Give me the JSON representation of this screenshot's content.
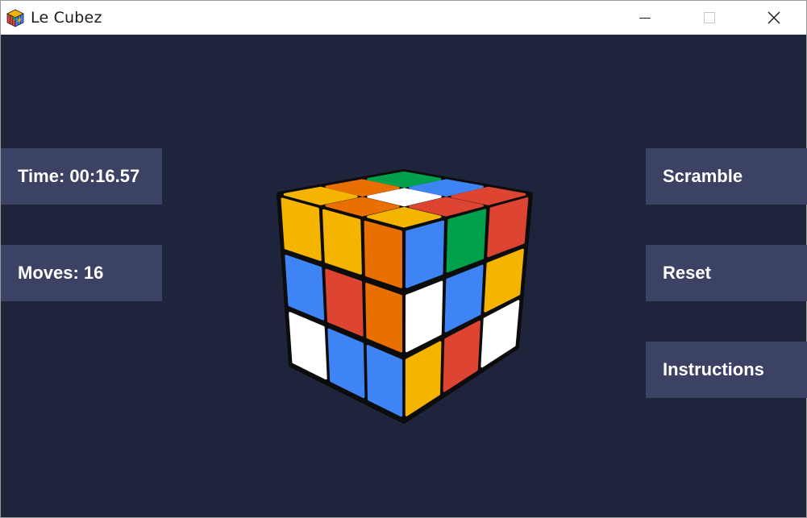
{
  "window": {
    "title": "Le Cubez",
    "icon": "rubiks-cube-icon",
    "controls": {
      "minimize_icon": "minimize-icon",
      "maximize_icon": "maximize-icon",
      "close_icon": "close-icon"
    }
  },
  "stats": {
    "time_label": "Time: ",
    "time_value": "00:16.57",
    "moves_label": "Moves: ",
    "moves_value": "16"
  },
  "actions": {
    "scramble_label": "Scramble",
    "reset_label": "Reset",
    "instructions_label": "Instructions"
  },
  "colors": {
    "background": "#1f243d",
    "panel": "#3b4263",
    "cube_white": "#ffffff",
    "cube_yellow": "#f5b400",
    "cube_red": "#de4432",
    "cube_orange": "#e86f00",
    "cube_blue": "#3f84f5",
    "cube_green": "#00a04d"
  },
  "cube": {
    "top_face": [
      [
        "green",
        "blue",
        "red"
      ],
      [
        "orange",
        "white",
        "red"
      ],
      [
        "yellow",
        "orange",
        "yellow"
      ]
    ],
    "left_face": [
      [
        "yellow",
        "yellow",
        "orange"
      ],
      [
        "blue",
        "red",
        "orange"
      ],
      [
        "white",
        "blue",
        "blue"
      ]
    ],
    "right_face": [
      [
        "blue",
        "green",
        "red"
      ],
      [
        "white",
        "blue",
        "yellow"
      ],
      [
        "yellow",
        "red",
        "white"
      ]
    ]
  }
}
